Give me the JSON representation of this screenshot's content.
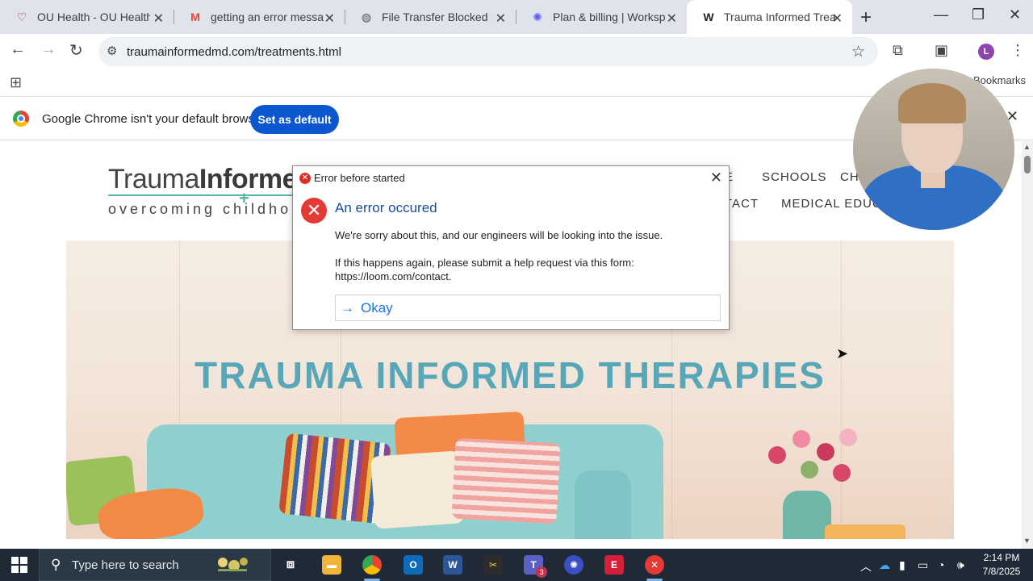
{
  "browser": {
    "tabs": [
      {
        "title": "OU Health - OU Health Hu",
        "favicon": "ou-health-icon",
        "active": false
      },
      {
        "title": "getting an error message",
        "favicon": "gmail-icon",
        "active": false
      },
      {
        "title": "File Transfer Blocked",
        "favicon": "globe-icon",
        "active": false
      },
      {
        "title": "Plan & billing | Workspace",
        "favicon": "workspace-icon",
        "active": false
      },
      {
        "title": "Trauma Informed Treatme",
        "favicon": "weebly-icon",
        "active": true
      }
    ],
    "url": "traumainformedmd.com/treatments.html",
    "profile_initial": "L",
    "bookmarks_label": "Bookmarks"
  },
  "infobar": {
    "message": "Google Chrome isn't your default browser",
    "button": "Set as default"
  },
  "site": {
    "logo_main_regular": "Trauma",
    "logo_main_bold": "Informed",
    "logo_sub": "overcoming childho",
    "nav": [
      "E",
      "SCHOOLS",
      "CH",
      "TACT",
      "MEDICAL EDUCA"
    ],
    "hero_title": "TRAUMA INFORMED THERAPIES"
  },
  "dialog": {
    "title": "Error before started",
    "heading": "An error occured",
    "message1": "We're sorry about this, and our engineers will be looking into the issue.",
    "message2": "If this happens again, please submit a help request via this form: https://loom.com/contact.",
    "button": "Okay",
    "accent_color": "#1a73e8"
  },
  "taskbar": {
    "search_placeholder": "Type here to search",
    "teams_badge": "3",
    "time": "2:14 PM",
    "date": "7/8/2025"
  }
}
